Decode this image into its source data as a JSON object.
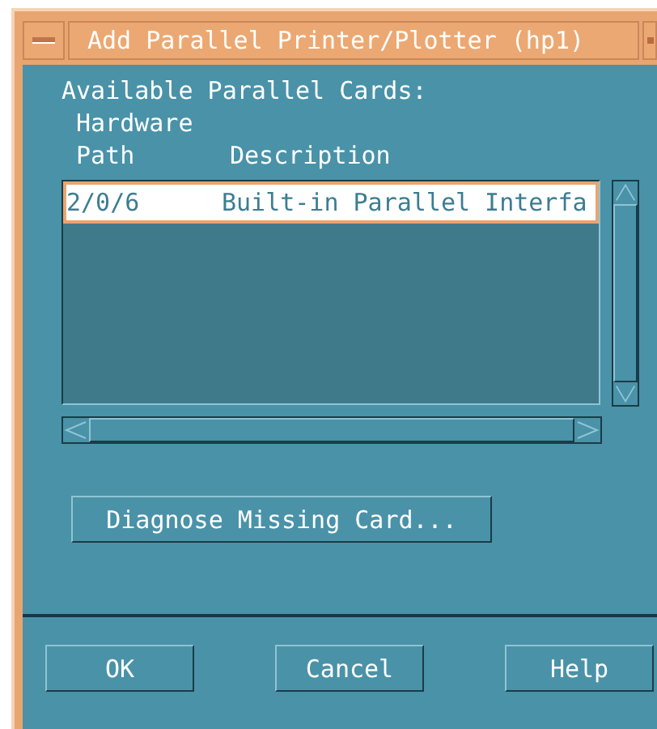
{
  "window": {
    "title": "Add Parallel Printer/Plotter (hp1)"
  },
  "list_label": "Available Parallel Cards:",
  "columns": [
    {
      "line_1": "Hardware",
      "line_2": "Path"
    },
    {
      "line_2": "Description"
    }
  ],
  "cards": [
    {
      "path": "2/0/6",
      "description": "Built-in Parallel Interfa",
      "selected": true
    }
  ],
  "diagnose_button": "Diagnose Missing Card...",
  "buttons": [
    "OK",
    "Cancel",
    "Help"
  ]
}
